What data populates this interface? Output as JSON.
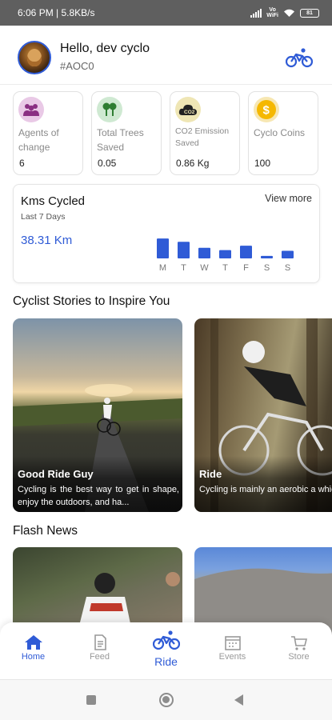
{
  "status_bar": {
    "time_speed": "6:06 PM | 5.8KB/s",
    "network_badge": "Vo\nWiFi",
    "battery": "81"
  },
  "header": {
    "greeting": "Hello, dev cyclo",
    "user_code": "#AOC0"
  },
  "stats": [
    {
      "label": "Agents of change",
      "value": "6",
      "icon": "people-icon",
      "color": "#e9c9e6",
      "icon_color": "#8a2f82"
    },
    {
      "label": "Total Trees Saved",
      "value": "0.05",
      "icon": "trees-icon",
      "color": "#cfe9d2",
      "icon_color": "#2e7d32"
    },
    {
      "label": "CO2 Emission Saved",
      "value": "0.86 Kg",
      "icon": "co2-cloud-icon",
      "color": "#efe6b5",
      "icon_color": "#222222"
    },
    {
      "label": "Cyclo Coins",
      "value": "100",
      "icon": "coin-icon",
      "color": "#f7e7b2",
      "icon_color": "#f5b800"
    }
  ],
  "kms": {
    "title": "Kms Cycled",
    "subtitle": "Last 7 Days",
    "view_more": "View more",
    "value": "38.31 Km"
  },
  "chart_data": {
    "type": "bar",
    "categories": [
      "M",
      "T",
      "W",
      "T",
      "F",
      "S",
      "S"
    ],
    "values": [
      8.6,
      7.2,
      4.6,
      3.6,
      5.5,
      1.1,
      3.3
    ],
    "title": "",
    "xlabel": "",
    "ylabel": "",
    "ylim": [
      0,
      9
    ],
    "color": "#2f5bd6"
  },
  "stories": {
    "section_title": "Cyclist Stories to Inspire You",
    "items": [
      {
        "title": "Good Ride Guy",
        "text": "Cycling is the best way to get in shape, enjoy the outdoors, and ha..."
      },
      {
        "title": "Ride",
        "text": "Cycling is mainly an aerobic a which means that your heart,"
      }
    ]
  },
  "news": {
    "section_title": "Flash News"
  },
  "bottom_nav": [
    {
      "label": "Home",
      "icon": "home-icon",
      "active": true
    },
    {
      "label": "Feed",
      "icon": "document-icon",
      "active": false
    },
    {
      "label": "Ride",
      "icon": "bicycle-icon",
      "active": true
    },
    {
      "label": "Events",
      "icon": "calendar-icon",
      "active": false
    },
    {
      "label": "Store",
      "icon": "cart-icon",
      "active": false
    }
  ],
  "accent": "#2f5bd6"
}
